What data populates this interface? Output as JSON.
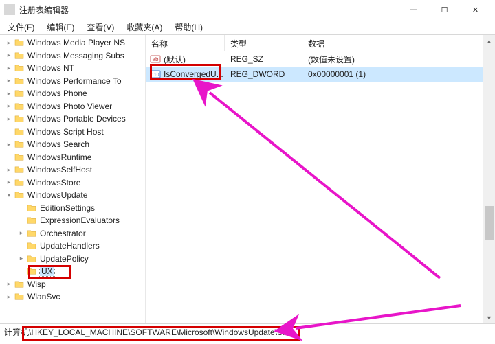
{
  "window": {
    "title": "注册表编辑器",
    "min": "—",
    "max": "☐",
    "close": "✕"
  },
  "menu": {
    "file": "文件(F)",
    "edit": "编辑(E)",
    "view": "查看(V)",
    "fav": "收藏夹(A)",
    "help": "帮助(H)"
  },
  "tree": {
    "items": [
      {
        "indent": 0,
        "toggle": "▸",
        "label": "Windows Media Player NS"
      },
      {
        "indent": 0,
        "toggle": "▸",
        "label": "Windows Messaging Subs"
      },
      {
        "indent": 0,
        "toggle": "▸",
        "label": "Windows NT"
      },
      {
        "indent": 0,
        "toggle": "▸",
        "label": "Windows Performance To"
      },
      {
        "indent": 0,
        "toggle": "▸",
        "label": "Windows Phone"
      },
      {
        "indent": 0,
        "toggle": "▸",
        "label": "Windows Photo Viewer"
      },
      {
        "indent": 0,
        "toggle": "▸",
        "label": "Windows Portable Devices"
      },
      {
        "indent": 0,
        "toggle": "",
        "label": "Windows Script Host"
      },
      {
        "indent": 0,
        "toggle": "▸",
        "label": "Windows Search"
      },
      {
        "indent": 0,
        "toggle": "",
        "label": "WindowsRuntime"
      },
      {
        "indent": 0,
        "toggle": "▸",
        "label": "WindowsSelfHost"
      },
      {
        "indent": 0,
        "toggle": "▸",
        "label": "WindowsStore"
      },
      {
        "indent": 0,
        "toggle": "▾",
        "label": "WindowsUpdate"
      },
      {
        "indent": 1,
        "toggle": "",
        "label": "EditionSettings"
      },
      {
        "indent": 1,
        "toggle": "",
        "label": "ExpressionEvaluators"
      },
      {
        "indent": 1,
        "toggle": "▸",
        "label": "Orchestrator"
      },
      {
        "indent": 1,
        "toggle": "",
        "label": "UpdateHandlers"
      },
      {
        "indent": 1,
        "toggle": "▸",
        "label": "UpdatePolicy"
      },
      {
        "indent": 1,
        "toggle": "",
        "label": "UX",
        "selected": true
      },
      {
        "indent": 0,
        "toggle": "▸",
        "label": "Wisp"
      },
      {
        "indent": 0,
        "toggle": "▸",
        "label": "WlanSvc"
      }
    ]
  },
  "columns": {
    "name": "名称",
    "type": "类型",
    "data": "数据"
  },
  "values": [
    {
      "icon": "str",
      "name": "(默认)",
      "type": "REG_SZ",
      "data": "(数值未设置)",
      "selected": false
    },
    {
      "icon": "bin",
      "name": "IsConvergedU...",
      "type": "REG_DWORD",
      "data": "0x00000001 (1)",
      "selected": true
    }
  ],
  "statusbar": {
    "prefix": "计算机",
    "path": "\\HKEY_LOCAL_MACHINE\\SOFTWARE\\Microsoft\\WindowsUpdate\\UX"
  },
  "colors": {
    "annotation_red": "#d40000",
    "annotation_magenta": "#e815c9",
    "selection_bg": "#cce8ff"
  }
}
